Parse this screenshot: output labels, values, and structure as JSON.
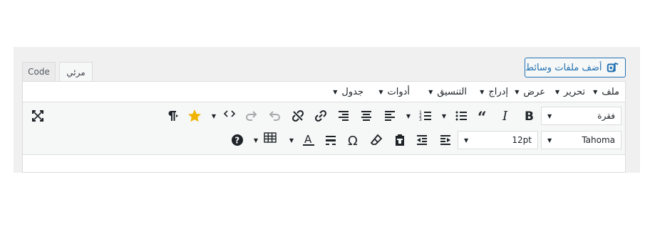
{
  "tabs": {
    "code": "Code",
    "visual": "مرئي"
  },
  "media_button": {
    "label": "أضف ملفات وسائط"
  },
  "menubar": {
    "items": [
      {
        "label": "ملف"
      },
      {
        "label": "تحرير"
      },
      {
        "label": "عرض"
      },
      {
        "label": "إدراج"
      },
      {
        "label": "التنسيق"
      },
      {
        "label": "أدوات"
      },
      {
        "label": "جدول"
      }
    ],
    "caret": "▼"
  },
  "toolbar": {
    "format_select": "فقرة",
    "font_family_select": "Tahoma",
    "font_size_select": "12pt",
    "arrow": "▼",
    "icons_row1": [
      "bold-icon",
      "italic-icon",
      "blockquote-icon",
      "bullet-list-icon",
      "numbered-list-icon",
      "align-left-icon",
      "align-center-icon",
      "align-right-icon",
      "link-icon",
      "unlink-icon",
      "undo-icon",
      "redo-icon",
      "code-icon",
      "star-icon",
      "paragraph-rtl-icon",
      "fullscreen-icon"
    ],
    "icons_row2": [
      "indent-icon",
      "outdent-icon",
      "paste-text-icon",
      "clear-formatting-icon",
      "special-character-icon",
      "horizontal-line-icon",
      "text-color-icon",
      "table-icon",
      "help-icon"
    ],
    "colors": {
      "star": "#f0b400",
      "accent": "#2271b1"
    }
  }
}
